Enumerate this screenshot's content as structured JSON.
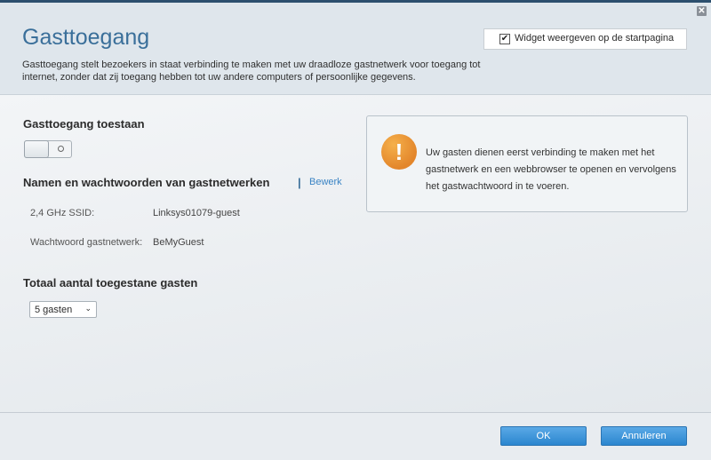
{
  "header": {
    "title": "Gasttoegang",
    "description": "Gasttoegang stelt bezoekers in staat verbinding te maken met uw draadloze gastnetwerk voor toegang tot internet, zonder dat zij toegang hebben tot uw andere computers of persoonlijke gegevens.",
    "widget_checkbox": {
      "label": "Widget weergeven op de startpagina",
      "checked": true,
      "check_glyph": "✔"
    },
    "close_glyph": "✕"
  },
  "main": {
    "allow_section": {
      "title": "Gasttoegang toestaan",
      "toggle_state": "off"
    },
    "networks_section": {
      "title": "Namen en wachtwoorden van gastnetwerken",
      "separator": "|",
      "edit_label": "Bewerk",
      "fields": [
        {
          "label": "2,4 GHz SSID:",
          "value": "Linksys01079-guest"
        },
        {
          "label": "Wachtwoord gastnetwerk:",
          "value": "BeMyGuest"
        }
      ]
    },
    "guests_section": {
      "title": "Totaal aantal toegestane gasten",
      "selected": "5 gasten",
      "chevron": "⌄"
    },
    "notice": {
      "icon": "warning-icon",
      "icon_glyph": "!",
      "text": "Uw gasten dienen eerst verbinding te maken met het gastnetwerk en een webbrowser te openen en vervolgens het gastwachtwoord in te voeren."
    }
  },
  "footer": {
    "ok_label": "OK",
    "cancel_label": "Annuleren"
  },
  "colors": {
    "title": "#3a6f9a",
    "link": "#3a83c4",
    "button": "#2b86cf",
    "warning": "#e3862b"
  }
}
